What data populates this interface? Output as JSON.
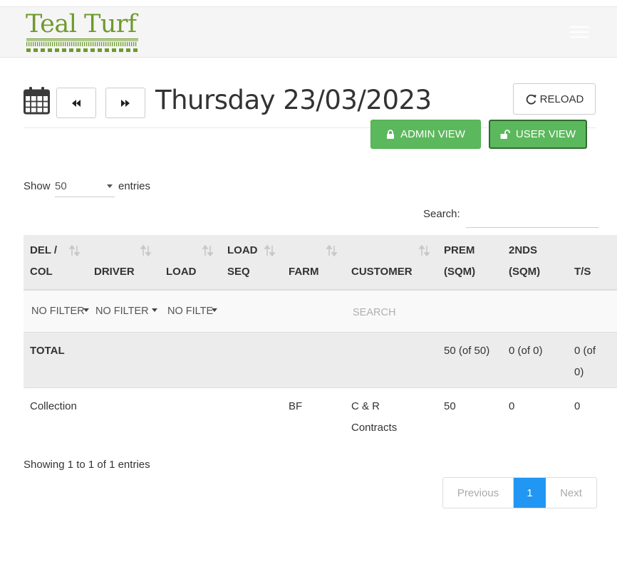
{
  "brand": {
    "name": "Teal Turf",
    "color": "#6f9a2c"
  },
  "header": {
    "date_title": "Thursday 23/03/2023",
    "reload_label": "RELOAD",
    "admin_view_label": "ADMIN VIEW",
    "user_view_label": "USER VIEW"
  },
  "table_controls": {
    "show_label": "Show",
    "page_length": "50",
    "entries_label": "entries",
    "search_label": "Search:"
  },
  "columns": [
    {
      "line1": "DEL /",
      "line2": "COL"
    },
    {
      "line1": "",
      "line2": "DRIVER"
    },
    {
      "line1": "",
      "line2": "LOAD"
    },
    {
      "line1": "LOAD",
      "line2": "SEQ"
    },
    {
      "line1": "",
      "line2": "FARM"
    },
    {
      "line1": "",
      "line2": "CUSTOMER"
    },
    {
      "line1": "PREM",
      "line2": "(SQM)"
    },
    {
      "line1": "2NDS",
      "line2": "(SQM)"
    },
    {
      "line1": "",
      "line2": "T/S"
    }
  ],
  "filters": {
    "del_col": "NO FILTER",
    "driver": "NO FILTER",
    "load": "NO FILTE",
    "customer_placeholder": "SEARCH"
  },
  "total_row": {
    "label": "TOTAL",
    "prem": "50 (of 50)",
    "nds": "0 (of 0)",
    "ts_line1": "0 (of",
    "ts_line2": "0)"
  },
  "rows": [
    {
      "del_col": "Collection",
      "driver": "",
      "load": "",
      "load_seq": "",
      "farm": "BF",
      "customer_line1": "C & R",
      "customer_line2": "Contracts",
      "prem": "50",
      "nds": "0",
      "ts": "0"
    }
  ],
  "footer": {
    "showing": "Showing 1 to 1 of 1 entries",
    "prev_label": "Previous",
    "current_page": "1",
    "next_label": "Next"
  },
  "colors": {
    "success": "#5cb85c",
    "primary": "#2196f3",
    "header_bg": "#ececec"
  }
}
